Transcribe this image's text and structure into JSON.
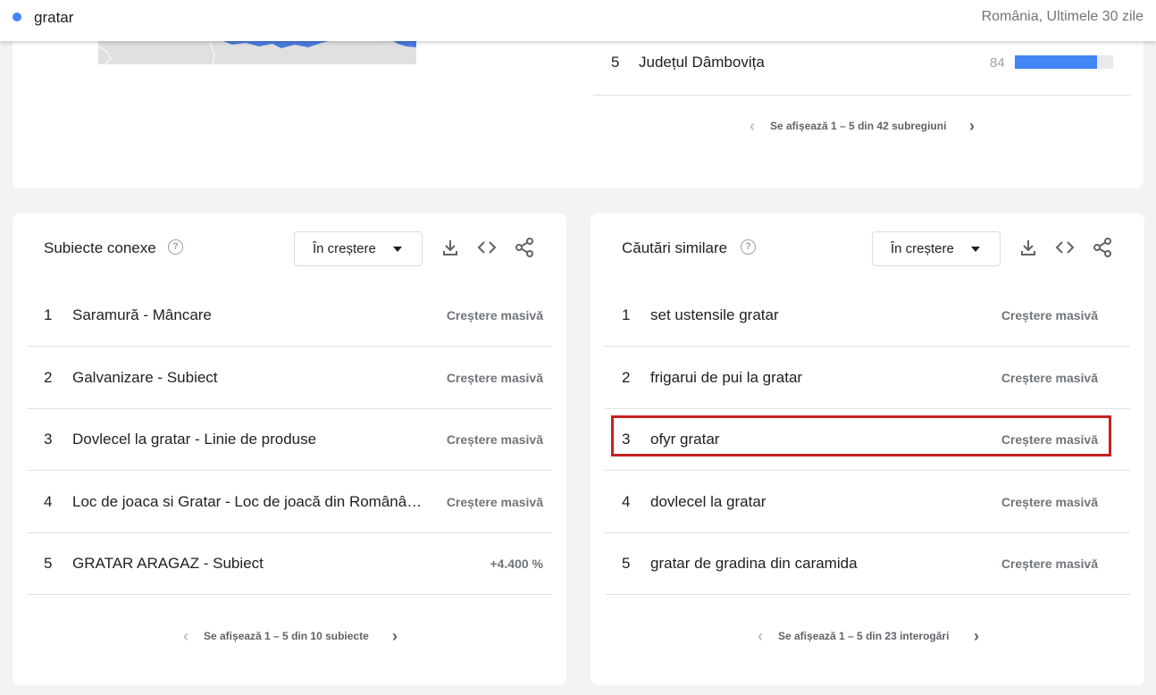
{
  "header": {
    "search_term": "gratar",
    "term_color": "#4285f4",
    "scope": "România, Ultimele 30 zile"
  },
  "regions": {
    "row": {
      "rank": "5",
      "name": "Județul Dâmbovița",
      "value": "84",
      "fill_fraction": 0.84
    },
    "pager": "Se afișează 1 – 5 din 42 subregiuni"
  },
  "related_topics": {
    "title": "Subiecte conexe",
    "dropdown": "În creștere",
    "items": [
      {
        "rank": "1",
        "name": "Saramură - Mâncare",
        "trend": "Creștere masivă"
      },
      {
        "rank": "2",
        "name": "Galvanizare - Subiect",
        "trend": "Creștere masivă"
      },
      {
        "rank": "3",
        "name": "Dovlecel la gratar - Linie de produse",
        "trend": "Creștere masivă"
      },
      {
        "rank": "4",
        "name": "Loc de joaca si Gratar - Loc de joacă din Românâ…",
        "trend": "Creștere masivă"
      },
      {
        "rank": "5",
        "name": "GRATAR ARAGAZ - Subiect",
        "trend": "+4.400 %"
      }
    ],
    "pager": "Se afișează 1 – 5 din 10 subiecte"
  },
  "related_queries": {
    "title": "Căutări similare",
    "dropdown": "În creștere",
    "items": [
      {
        "rank": "1",
        "name": "set ustensile gratar",
        "trend": "Creștere masivă"
      },
      {
        "rank": "2",
        "name": "frigarui de pui la gratar",
        "trend": "Creștere masivă"
      },
      {
        "rank": "3",
        "name": "ofyr gratar",
        "trend": "Creștere masivă"
      },
      {
        "rank": "4",
        "name": "dovlecel la gratar",
        "trend": "Creștere masivă"
      },
      {
        "rank": "5",
        "name": "gratar de gradina din caramida",
        "trend": "Creștere masivă"
      }
    ],
    "pager": "Se afișează 1 – 5 din 23 interogări"
  },
  "icons": [
    "help-icon",
    "download-icon",
    "embed-code-icon",
    "share-icon",
    "chevron-left-icon",
    "chevron-right-icon",
    "dropdown-arrow-icon"
  ],
  "highlight_color": "#c5221f"
}
